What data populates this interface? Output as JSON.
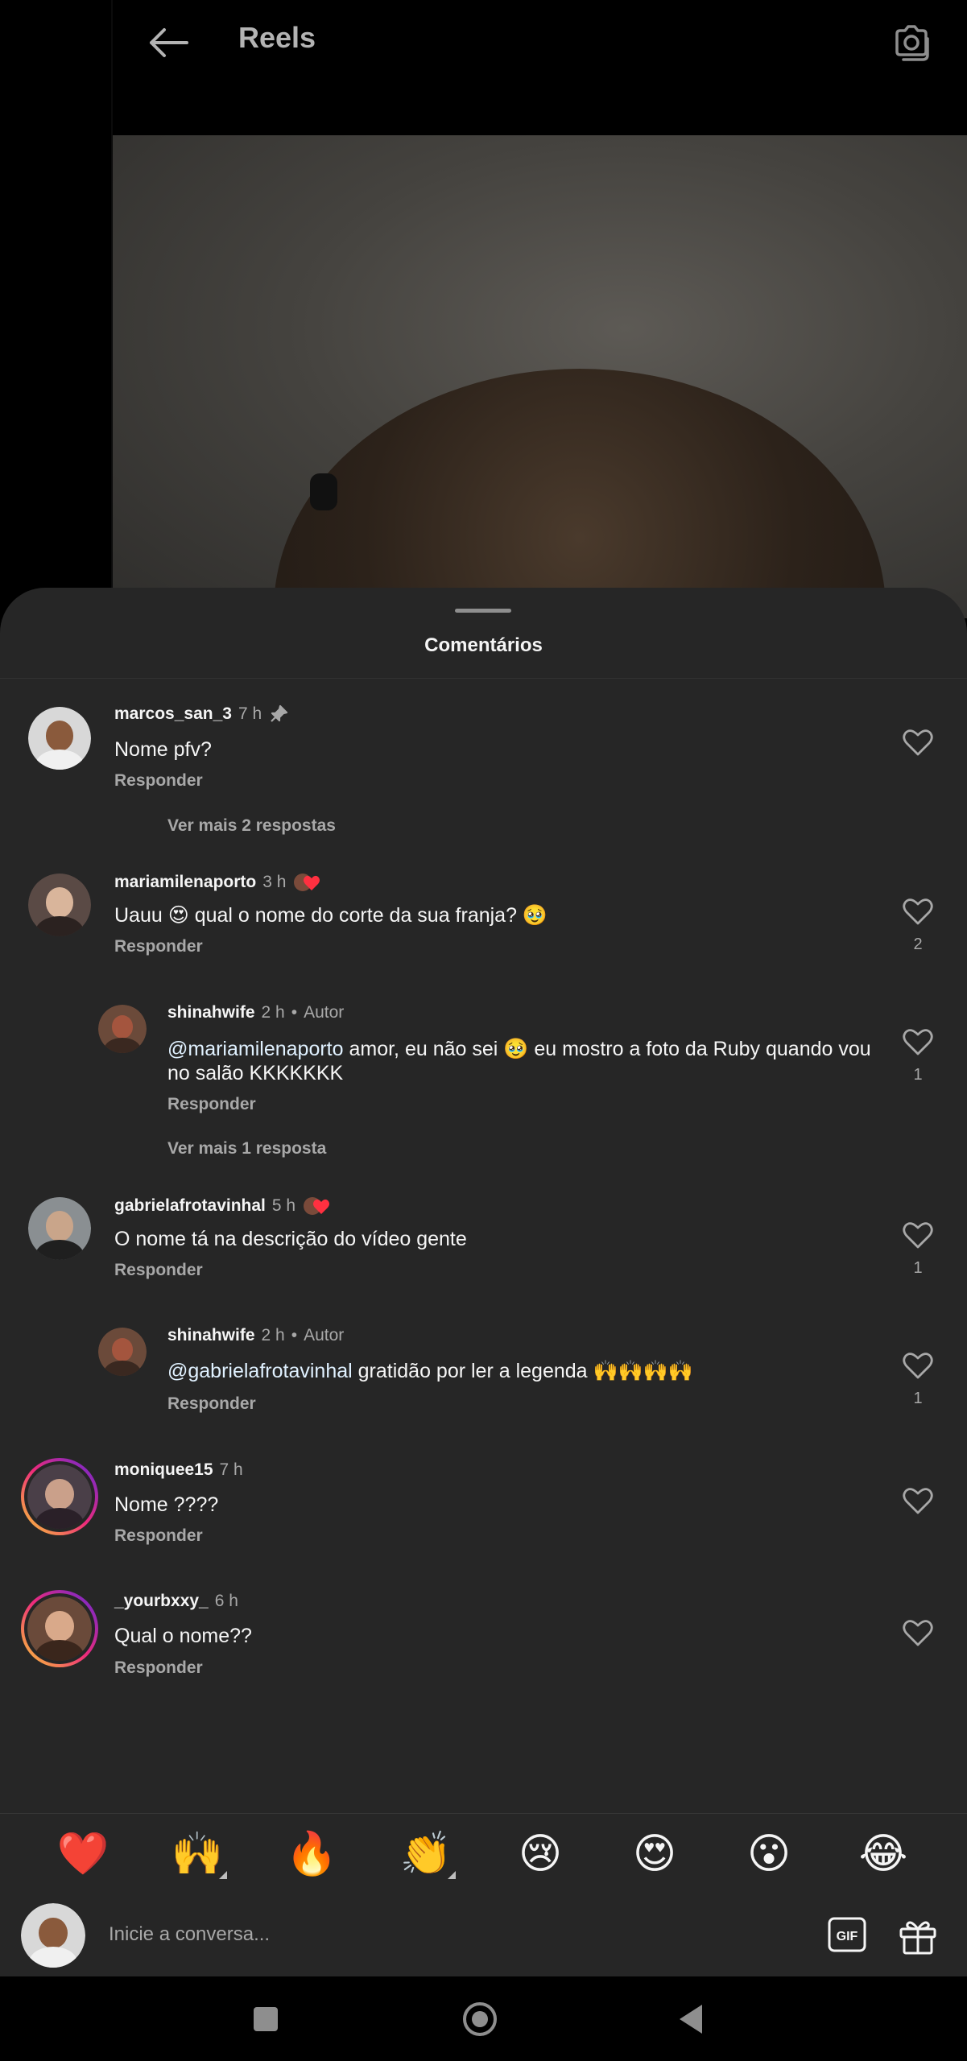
{
  "header": {
    "title": "Reels"
  },
  "sheet": {
    "title": "Comentários"
  },
  "comments": [
    {
      "user": "marcos_san_3",
      "time": "7 h",
      "text": "Nome pfv?",
      "reply": "Responder",
      "more": "Ver mais 2 respostas"
    },
    {
      "user": "mariamilenaporto",
      "time": "3 h",
      "text": "Uauu 😍 qual o nome do corte da sua franja? 🥹",
      "reply": "Responder",
      "likes": "2"
    },
    {
      "user": "shinahwife",
      "time": "2 h",
      "author": "Autor",
      "mention": "@mariamilenaporto",
      "text": " amor, eu não sei 🥹 eu mostro a foto da Ruby quando vou no salão KKKKKKK",
      "reply": "Responder",
      "likes": "1",
      "more": "Ver mais 1 resposta"
    },
    {
      "user": "gabrielafrotavinhal",
      "time": "5 h",
      "text": "O nome tá na descrição do vídeo gente",
      "reply": "Responder",
      "likes": "1"
    },
    {
      "user": "shinahwife",
      "time": "2 h",
      "author": "Autor",
      "mention": "@gabrielafrotavinhal",
      "text": " gratidão por ler a legenda 🙌🙌🙌🙌",
      "reply": "Responder",
      "likes": "1"
    },
    {
      "user": "moniquee15",
      "time": "7 h",
      "text": "Nome ????",
      "reply": "Responder"
    },
    {
      "user": "_yourbxxy_",
      "time": "6 h",
      "text": "Qual o nome??",
      "reply": "Responder"
    }
  ],
  "emojis": [
    "❤️",
    "🙌",
    "🔥",
    "👏",
    "😢",
    "😍",
    "😮",
    "😂"
  ],
  "composer": {
    "placeholder": "Inicie a conversa..."
  },
  "icons": {
    "back": "back-arrow-icon",
    "camera": "camera-icon",
    "pin": "pin-icon",
    "heart": "heart-outline-icon",
    "gif": "gif-icon",
    "gift": "gift-icon"
  },
  "colors": {
    "background": "#000000",
    "sheet": "#262626",
    "muted": "#a8a8a8",
    "text": "#f5f5f5"
  }
}
